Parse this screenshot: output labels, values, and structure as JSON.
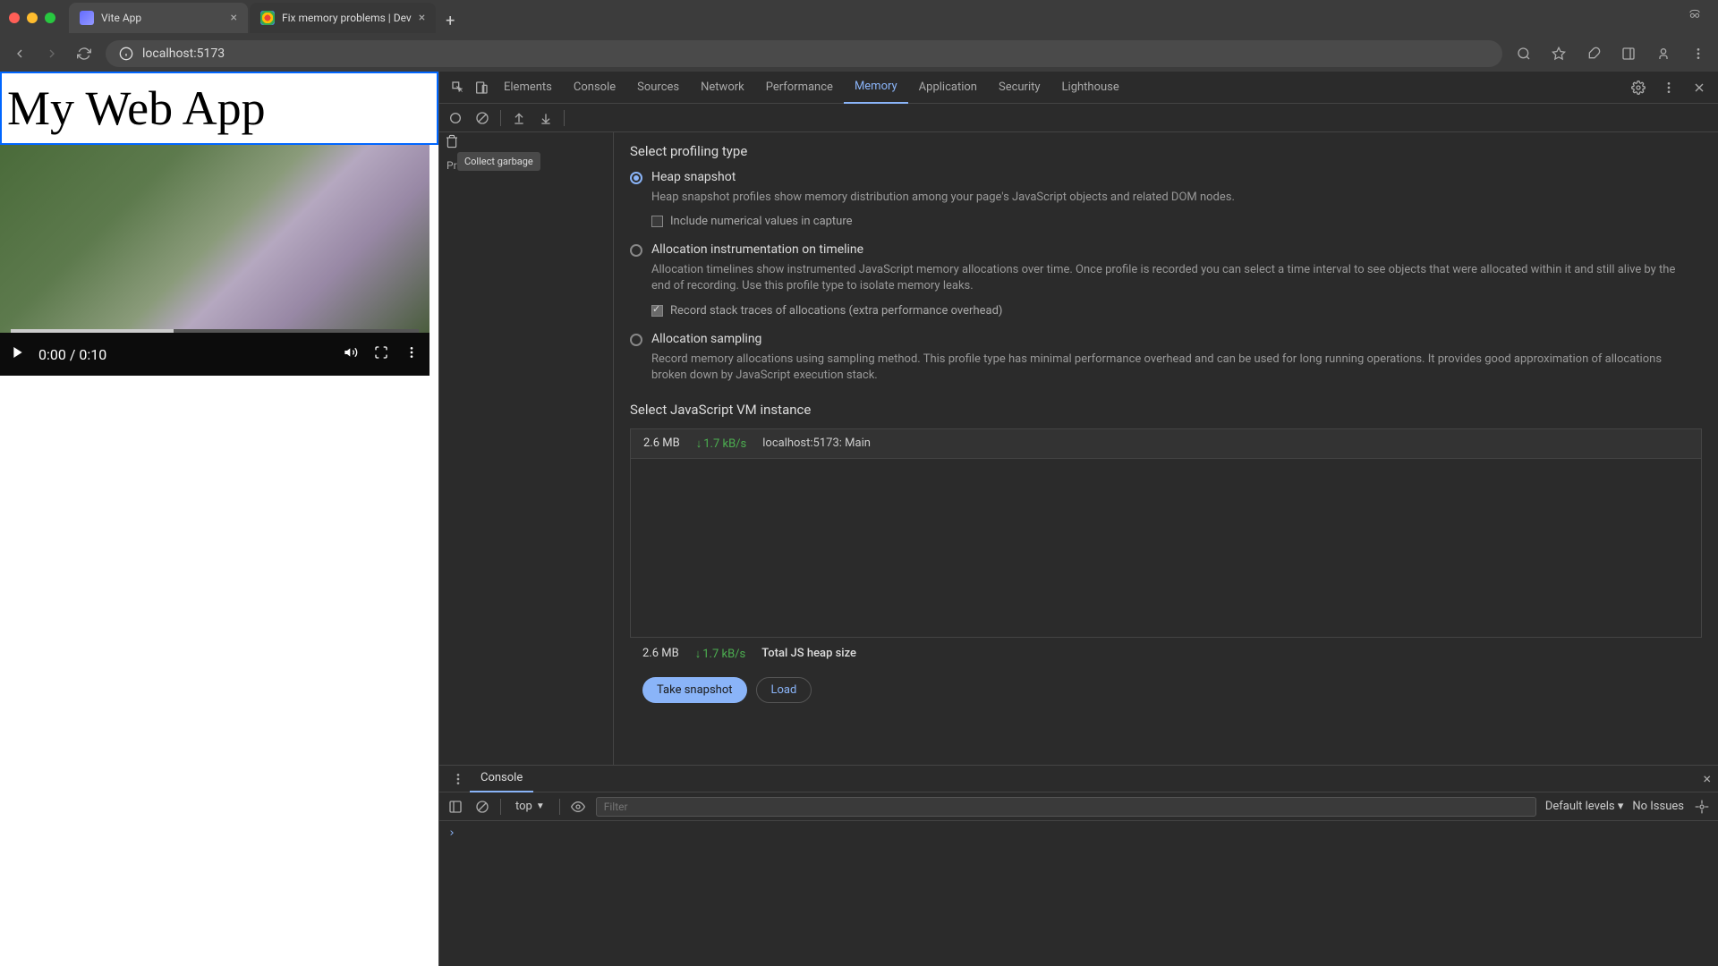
{
  "browser": {
    "tabs": [
      {
        "title": "Vite App",
        "active": true
      },
      {
        "title": "Fix memory problems  |  Dev",
        "active": false
      }
    ],
    "url": "localhost:5173"
  },
  "page": {
    "heading": "My Web App",
    "video": {
      "current_time": "0:00",
      "duration": "0:10",
      "time_display": "0:00 / 0:10"
    }
  },
  "devtools": {
    "tabs": [
      "Elements",
      "Console",
      "Sources",
      "Network",
      "Performance",
      "Memory",
      "Application",
      "Security",
      "Lighthouse"
    ],
    "active_tab": "Memory",
    "tooltip": "Collect garbage",
    "sidebar_label": "Profiles",
    "memory": {
      "section1_title": "Select profiling type",
      "options": [
        {
          "label": "Heap snapshot",
          "desc": "Heap snapshot profiles show memory distribution among your page's JavaScript objects and related DOM nodes.",
          "checked": true,
          "checkbox_label": "Include numerical values in capture",
          "checkbox_checked": false
        },
        {
          "label": "Allocation instrumentation on timeline",
          "desc": "Allocation timelines show instrumented JavaScript memory allocations over time. Once profile is recorded you can select a time interval to see objects that were allocated within it and still alive by the end of recording. Use this profile type to isolate memory leaks.",
          "checked": false,
          "checkbox_label": "Record stack traces of allocations (extra performance overhead)",
          "checkbox_checked": true
        },
        {
          "label": "Allocation sampling",
          "desc": "Record memory allocations using sampling method. This profile type has minimal performance overhead and can be used for long running operations. It provides good approximation of allocations broken down by JavaScript execution stack.",
          "checked": false
        }
      ],
      "section2_title": "Select JavaScript VM instance",
      "vm": {
        "size": "2.6 MB",
        "rate": "1.7 kB/s",
        "name": "localhost:5173: Main"
      },
      "footer": {
        "size": "2.6 MB",
        "rate": "1.7 kB/s",
        "label": "Total JS heap size"
      },
      "buttons": {
        "primary": "Take snapshot",
        "secondary": "Load"
      }
    },
    "drawer": {
      "tab": "Console",
      "context": "top",
      "filter_placeholder": "Filter",
      "levels": "Default levels",
      "issues": "No Issues"
    }
  }
}
